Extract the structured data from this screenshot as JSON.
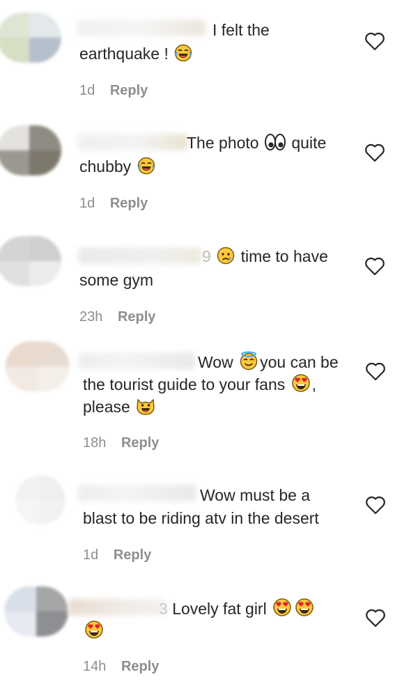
{
  "comments": [
    {
      "line1": "I felt the",
      "line2": "earthquake !",
      "line3": "",
      "emoji_after_line2": "tears-of-joy-emoji",
      "time": "1d",
      "reply_label": "Reply"
    },
    {
      "line1": "The photo",
      "line1_suffix": "quite",
      "line2": "chubby",
      "line3": "",
      "emoji_in_line1": "eyes-emoji",
      "emoji_after_line2": "tears-of-joy-emoji",
      "time": "1d",
      "reply_label": "Reply"
    },
    {
      "line1_prefix": "9",
      "line1": "time to have",
      "line2": "some gym",
      "line3": "",
      "emoji_in_line1": "sad-relieved-emoji",
      "time": "23h",
      "reply_label": "Reply"
    },
    {
      "line1": "Wow",
      "line1_suffix": "you can be",
      "line2": "the tourist guide to your fans",
      "line2_suffix": ",",
      "line3": "please",
      "emoji_in_line1": "halo-emoji",
      "emoji_after_line2": "heart-eyes-emoji",
      "emoji_after_line3": "grinning-cat-emoji",
      "time": "18h",
      "reply_label": "Reply"
    },
    {
      "line1": "Wow must be a",
      "line2": "blast to be riding atv in the desert",
      "line3": "",
      "time": "1d",
      "reply_label": "Reply"
    },
    {
      "line1_prefix": "3",
      "line1": "Lovely fat girl",
      "line2": "",
      "line3": "",
      "emoji_after_line1": "heart-eyes-emoji",
      "emoji_line2": "heart-eyes-emoji",
      "time": "14h",
      "reply_label": "Reply"
    }
  ],
  "icons": {
    "like": "heart-outline-icon"
  },
  "colors": {
    "text": "#262626",
    "meta": "#8e8e8e",
    "emoji_yellow": "#ffc83d",
    "emoji_red": "#e0242d"
  }
}
